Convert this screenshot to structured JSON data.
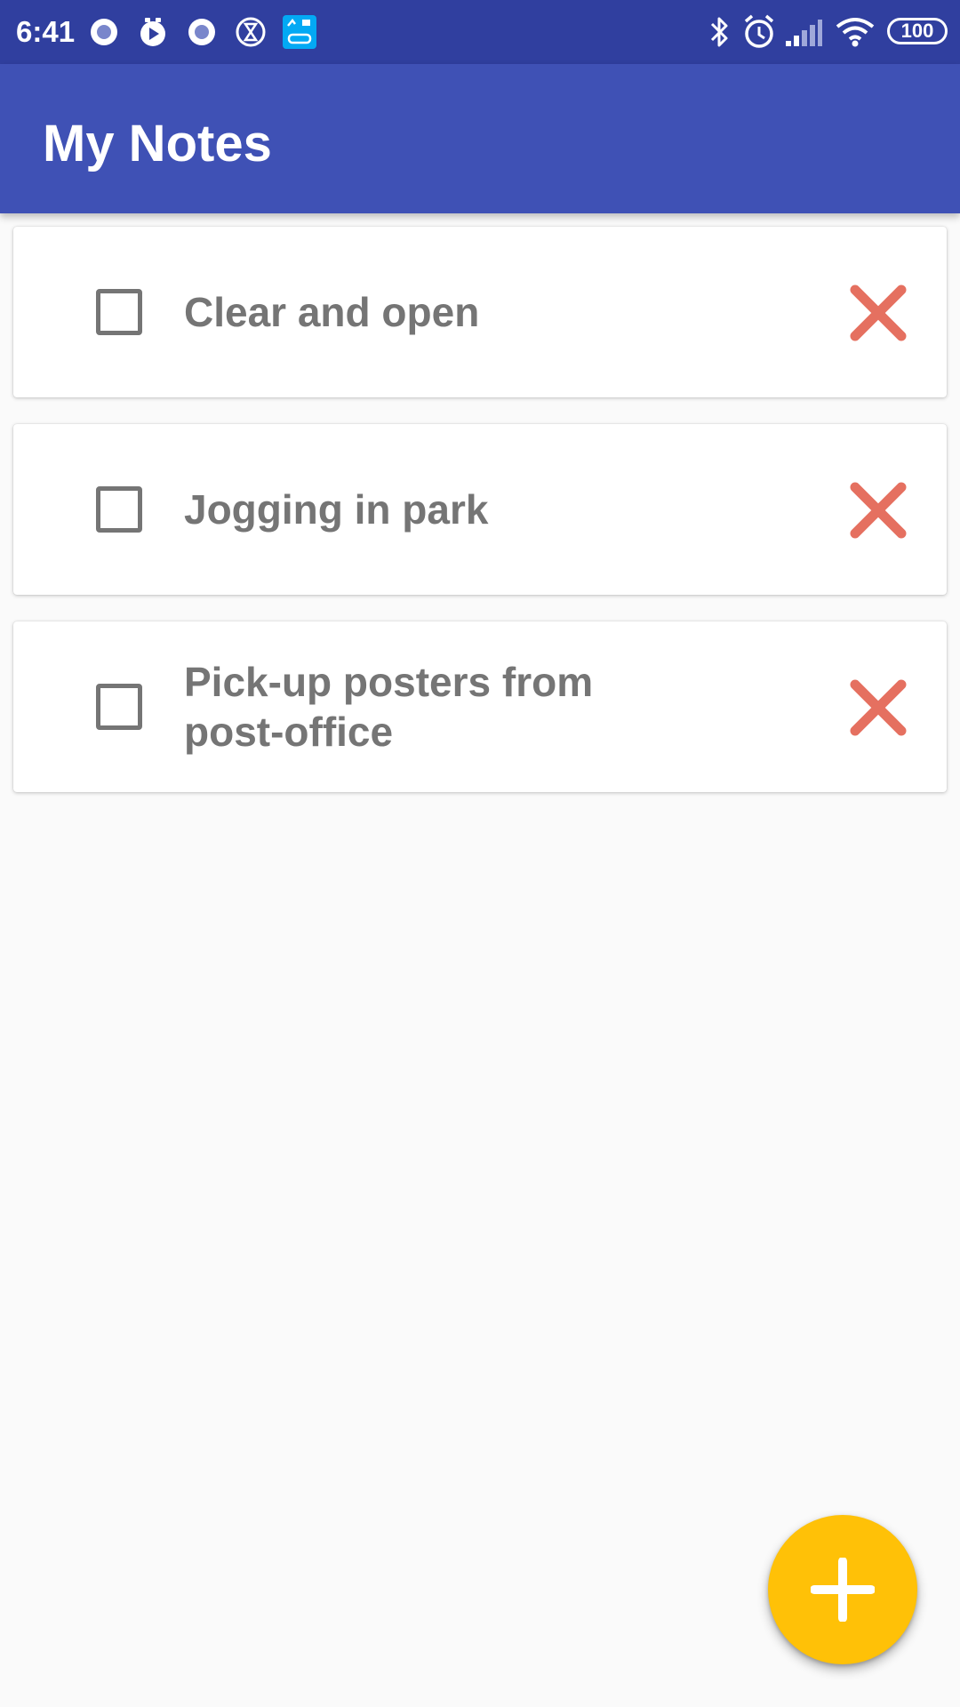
{
  "status_bar": {
    "time": "6:41",
    "battery": "100",
    "notification_icons": [
      "record-icon",
      "play-timer-icon",
      "record-icon",
      "hourglass-icon",
      "fitness-app-icon"
    ],
    "right_icons": [
      "bluetooth-icon",
      "alarm-icon",
      "signal-icon",
      "wifi-icon",
      "battery-icon"
    ]
  },
  "app_bar": {
    "title": "My Notes"
  },
  "notes": [
    {
      "text": "Clear and open",
      "checked": false
    },
    {
      "text": "Jogging in park",
      "checked": false
    },
    {
      "text": "Pick-up posters from post-office",
      "checked": false
    }
  ],
  "fab": {
    "icon": "plus-icon"
  },
  "colors": {
    "status_bar": "#303F9F",
    "app_bar": "#3F51B5",
    "background": "#FAFAFA",
    "delete_icon": "#E57060",
    "note_text": "#757575",
    "fab": "#FFC107"
  }
}
